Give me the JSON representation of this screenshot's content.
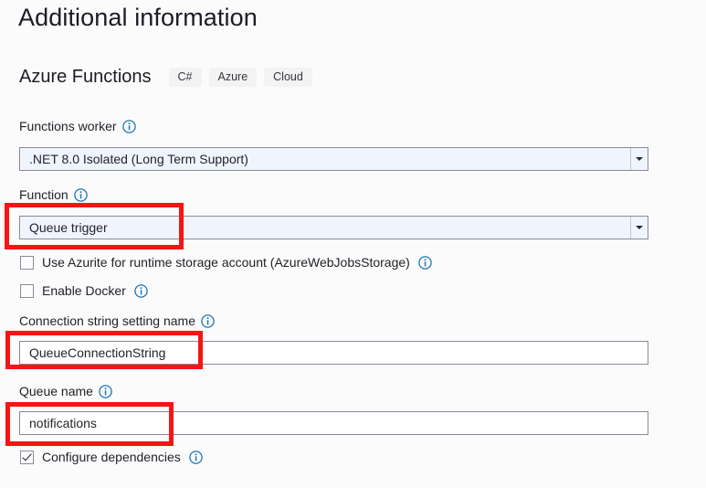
{
  "page": {
    "title": "Additional information",
    "background_color": "#fbfbfb",
    "highlight_color": "#f71414"
  },
  "section": {
    "title": "Azure Functions",
    "tags": [
      {
        "label": "C#"
      },
      {
        "label": "Azure"
      },
      {
        "label": "Cloud"
      }
    ]
  },
  "fields": {
    "functions_worker": {
      "label": "Functions worker",
      "info_icon": "info-icon",
      "value": ".NET 8.0 Isolated (Long Term Support)",
      "control": "combobox"
    },
    "function": {
      "label": "Function",
      "info_icon": "info-icon",
      "value": "Queue trigger",
      "control": "combobox",
      "highlighted": true
    },
    "use_azurite": {
      "label": "Use Azurite for runtime storage account (AzureWebJobsStorage)",
      "info_icon": "info-icon",
      "checked": false,
      "control": "checkbox"
    },
    "enable_docker": {
      "label": "Enable Docker",
      "info_icon": "info-icon",
      "checked": false,
      "control": "checkbox"
    },
    "connection_string_setting_name": {
      "label": "Connection string setting name",
      "info_icon": "info-icon",
      "value": "QueueConnectionString",
      "placeholder": "",
      "control": "textbox",
      "highlighted": true
    },
    "queue_name": {
      "label": "Queue name",
      "info_icon": "info-icon",
      "value": "notifications",
      "placeholder": "",
      "control": "textbox",
      "highlighted": true
    },
    "configure_dependencies": {
      "label": "Configure dependencies",
      "info_icon": "info-icon",
      "checked": true,
      "control": "checkbox"
    }
  }
}
